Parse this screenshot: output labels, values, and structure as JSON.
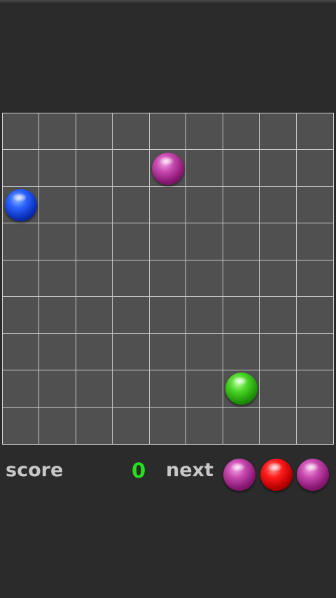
{
  "board": {
    "rows": 9,
    "cols": 9,
    "balls": [
      {
        "row": 1,
        "col": 4,
        "color": "magenta"
      },
      {
        "row": 2,
        "col": 0,
        "color": "blue"
      },
      {
        "row": 7,
        "col": 6,
        "color": "green"
      }
    ]
  },
  "score": {
    "label": "score",
    "value": "0"
  },
  "next": {
    "label": "next",
    "balls": [
      "magenta",
      "red",
      "magenta"
    ]
  },
  "colors": {
    "background": "#2b2b2b",
    "cell": "#505050",
    "grid_line": "#c9c9c9",
    "score_value": "#25e01c",
    "label_text": "#c8c8c8"
  }
}
